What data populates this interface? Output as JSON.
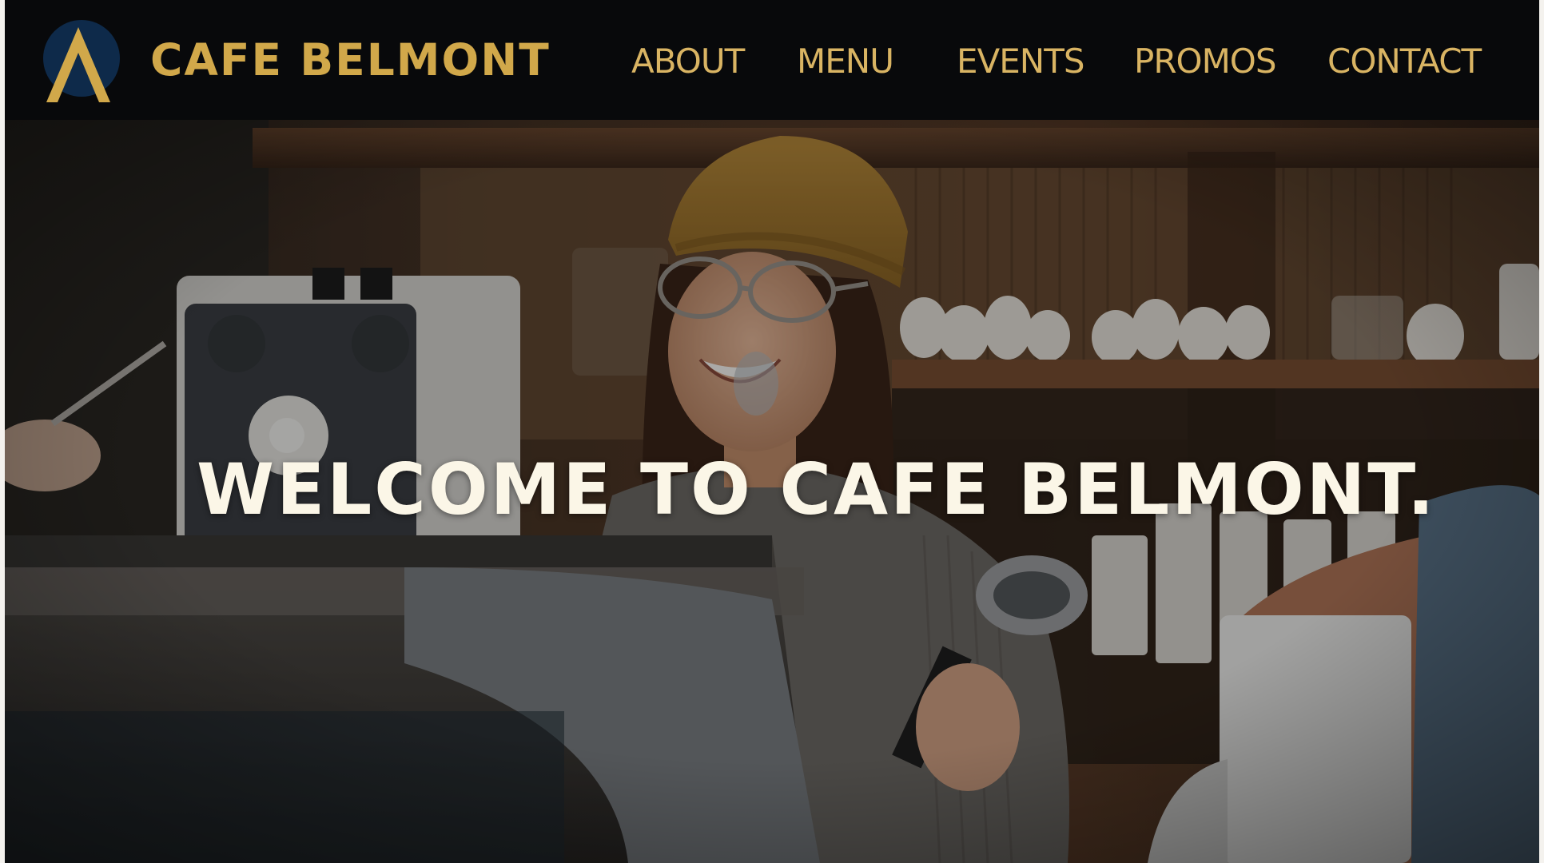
{
  "brand": {
    "name": "CAFE BELMONT",
    "logo": "chevron-a-logo",
    "colors": {
      "gold": "#d1a84a",
      "navy": "#0e2a4a",
      "header_bg": "#08090b"
    }
  },
  "nav": {
    "items": [
      {
        "label": "ABOUT"
      },
      {
        "label": "MENU"
      },
      {
        "label": "EVENTS"
      },
      {
        "label": "PROMOS"
      },
      {
        "label": "CONTACT"
      }
    ]
  },
  "hero": {
    "title": "WELCOME TO CAFE BELMONT.",
    "image": "barista-smiling-at-espresso-machine-photo"
  }
}
